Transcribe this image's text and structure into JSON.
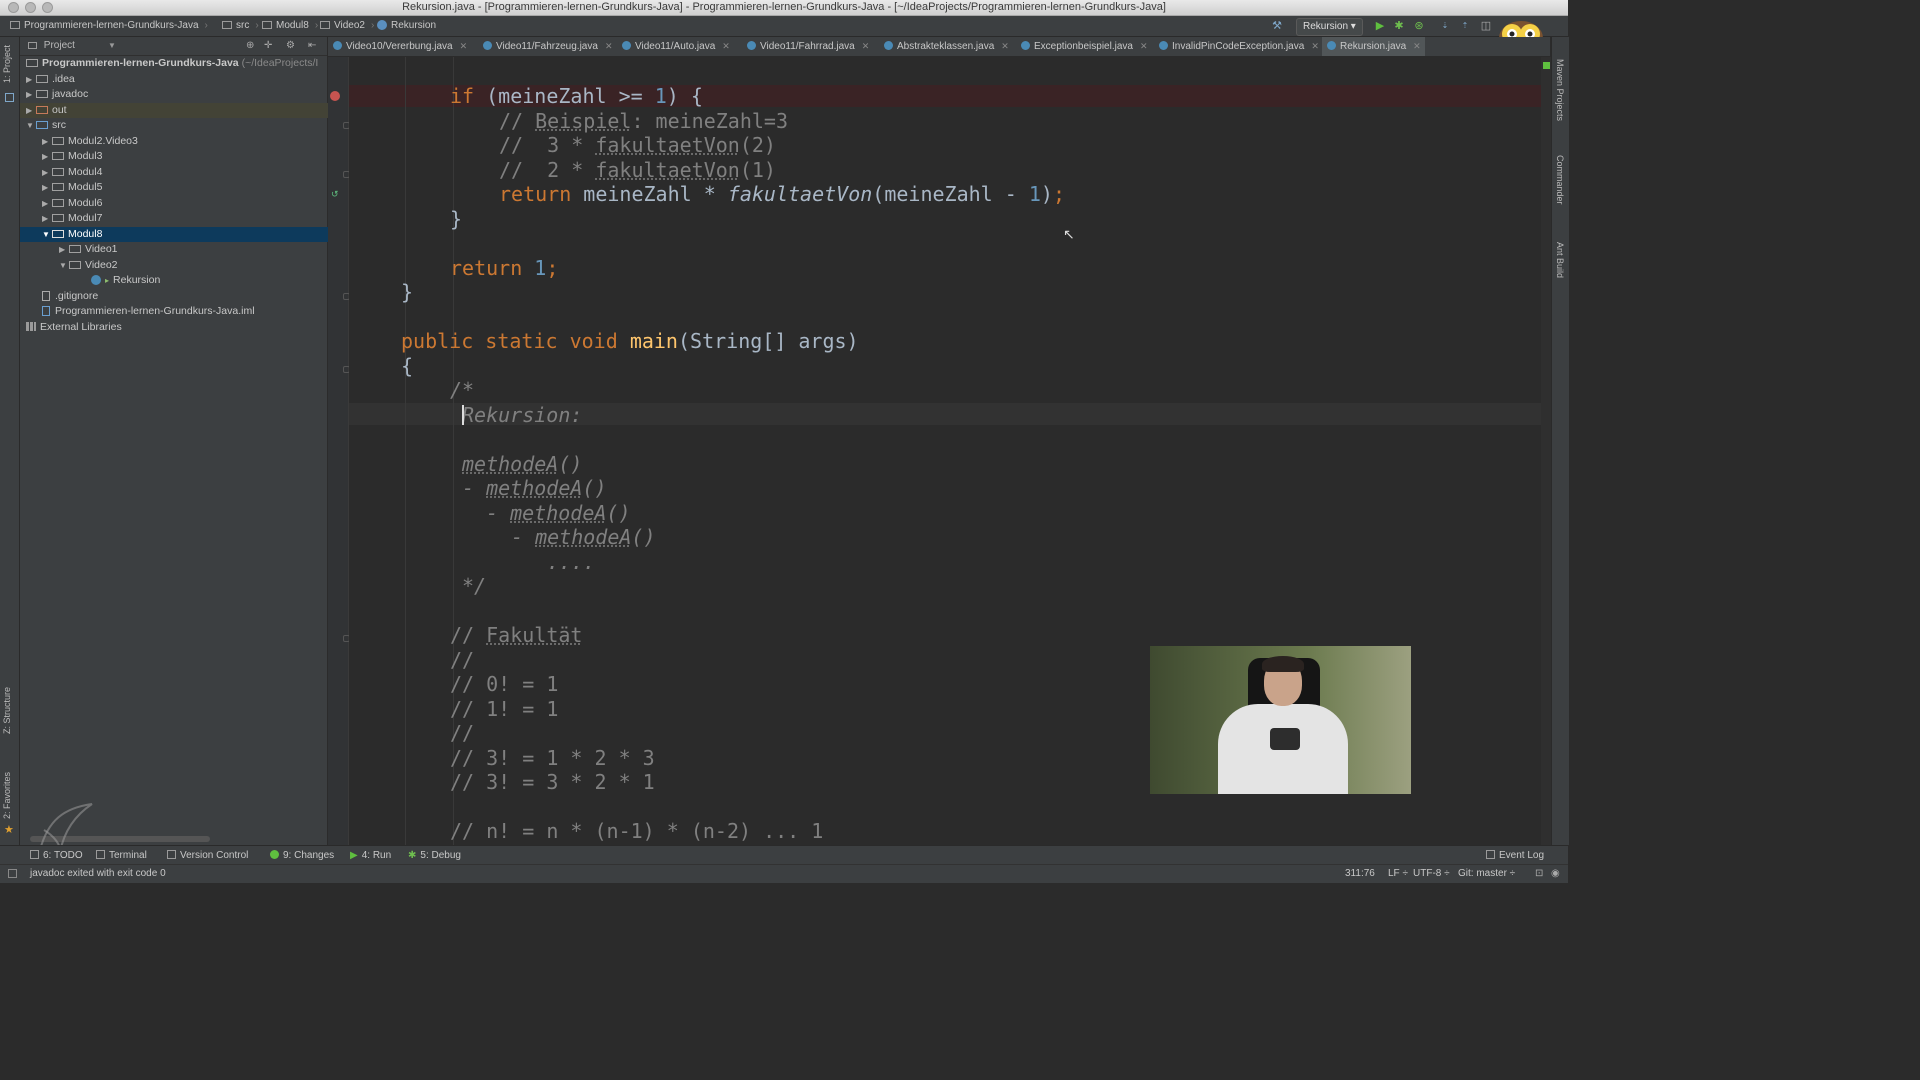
{
  "window": {
    "title": "Rekursion.java - [Programmieren-lernen-Grundkurs-Java] - Programmieren-lernen-Grundkurs-Java - [~/IdeaProjects/Programmieren-lernen-Grundkurs-Java]"
  },
  "navbar": {
    "crumbs": [
      "Programmieren-lernen-Grundkurs-Java",
      "src",
      "Modul8",
      "Video2",
      "Rekursion"
    ],
    "run_config": "Rekursion ▾"
  },
  "project_panel": {
    "header": "Project",
    "root": "Programmieren-lernen-Grundkurs-Java",
    "root_path": "(~/IdeaProjects/I",
    "items": [
      ".idea",
      "javadoc",
      "out",
      "src",
      "Modul2.Video3",
      "Modul3",
      "Modul4",
      "Modul5",
      "Modul6",
      "Modul7",
      "Modul8",
      "Video1",
      "Video2",
      "Rekursion",
      ".gitignore",
      "Programmieren-lernen-Grundkurs-Java.iml",
      "External Libraries"
    ]
  },
  "tabs": [
    "Video10/Vererbung.java",
    "Video11/Fahrzeug.java",
    "Video11/Auto.java",
    "Video11/Fahrrad.java",
    "Abstrakteklassen.java",
    "Exceptionbeispiel.java",
    "InvalidPinCodeException.java",
    "Rekursion.java"
  ],
  "editor": {
    "lines": [
      "if (meineZahl >= 1) {",
      "// Beispiel: meineZahl=3",
      "//  3 * fakultaetVon(2)",
      "//  2 * fakultaetVon(1)",
      "return meineZahl * fakultaetVon(meineZahl - 1);",
      "}",
      "return 1;",
      "}",
      "public static void main(String[] args)",
      "{",
      "/*",
      "Rekursion:",
      "methodeA()",
      "- methodeA()",
      "- methodeA()",
      "- methodeA()",
      "....",
      "*/",
      "// Fakultät",
      "//",
      "// 0! = 1",
      "// 1! = 1",
      "//",
      "// 3! = 1 * 2 * 3",
      "// 3! = 3 * 2 * 1",
      "// n! = n * (n-1) * (n-2) ... 1"
    ]
  },
  "tool_strips": {
    "left": [
      "1: Project",
      "Z: Structure",
      "2: Favorites"
    ],
    "right": [
      "Maven Projects",
      "Commander",
      "Ant Build"
    ]
  },
  "bottom_tabs": [
    "6: TODO",
    "Terminal",
    "Version Control",
    "9: Changes",
    "4: Run",
    "5: Debug"
  ],
  "event_log": "Event Log",
  "status": {
    "message": "javadoc exited with exit code 0",
    "position": "311:76",
    "line_sep": "LF ÷",
    "encoding": "UTF-8 ÷",
    "vcs": "Git: master ÷"
  },
  "colors": {
    "keyword": "#cc7832",
    "number": "#6897bb",
    "function": "#ffc66d",
    "comment": "#808080",
    "breakpoint": "#c75450"
  }
}
